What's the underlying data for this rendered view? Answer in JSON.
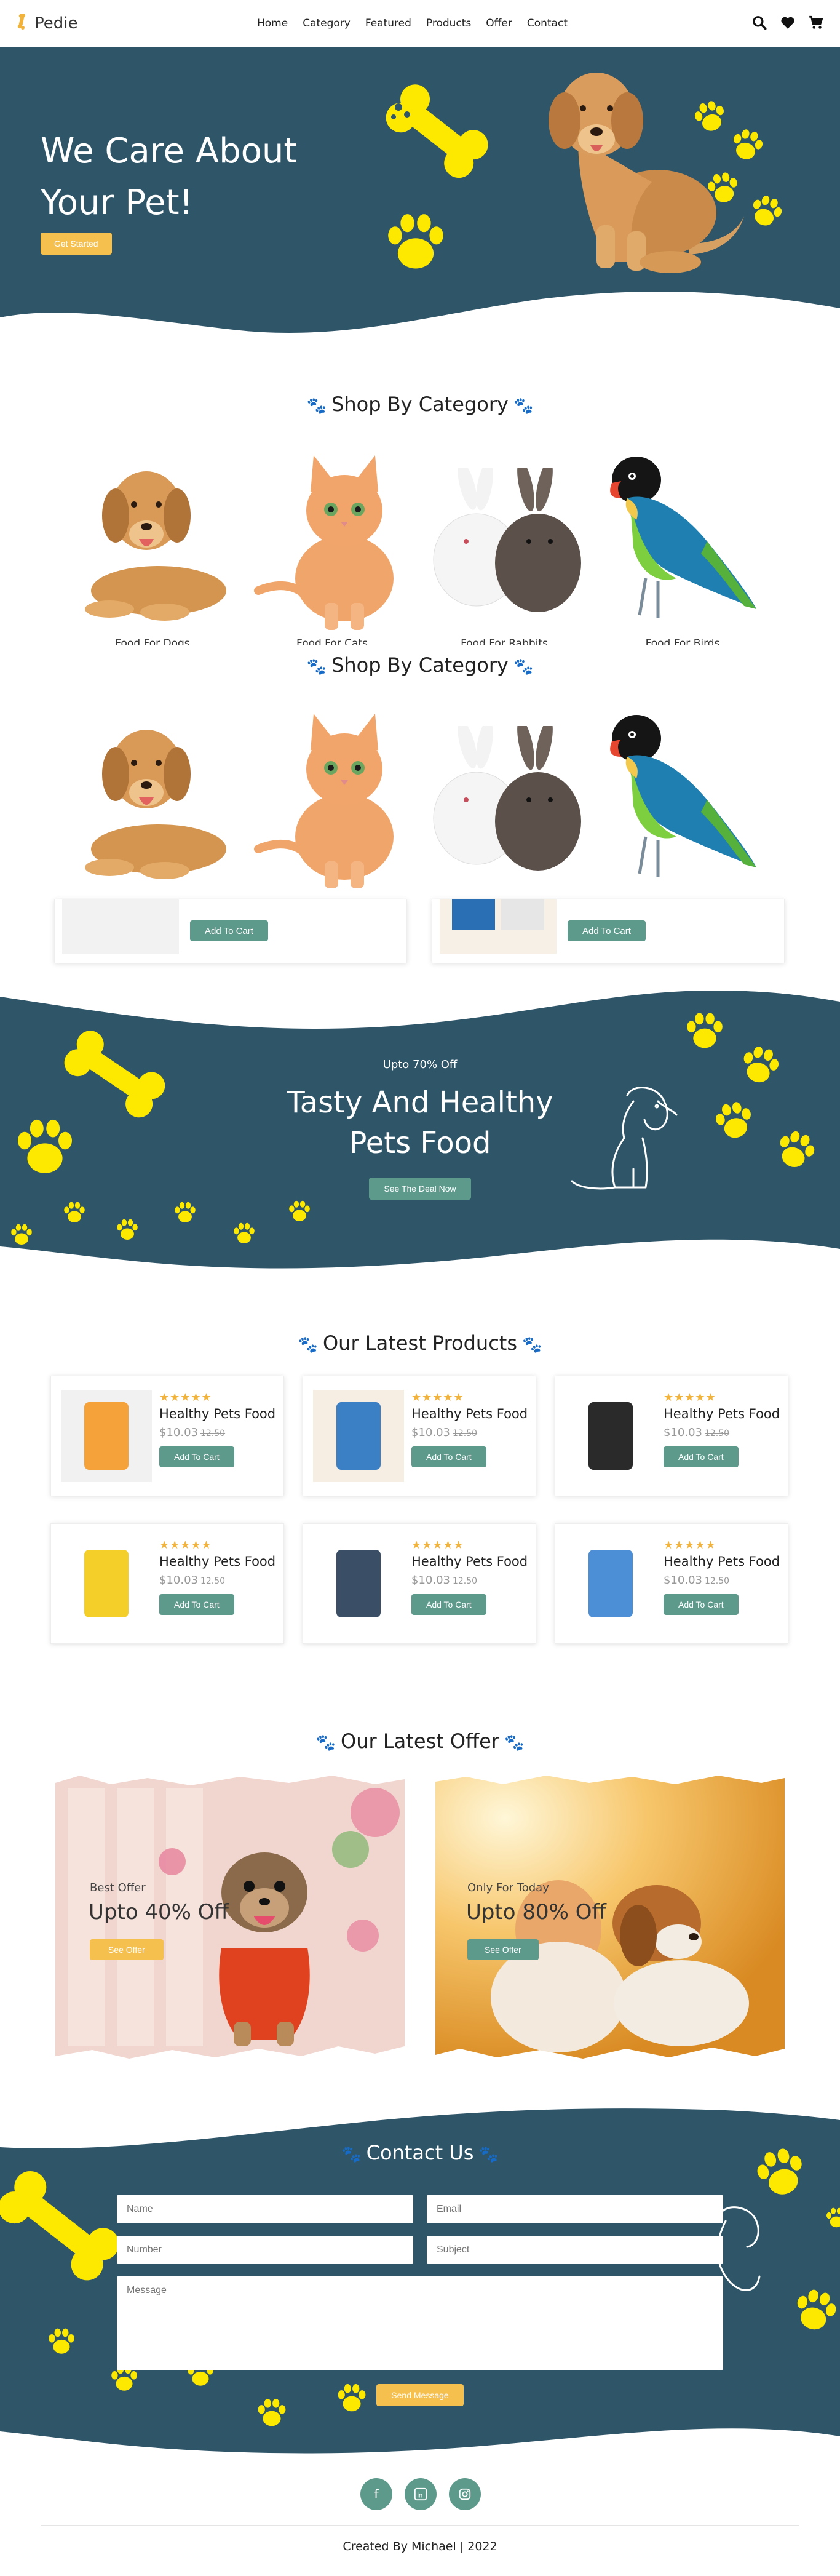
{
  "header": {
    "brand": "Pedie",
    "nav": [
      "Home",
      "Category",
      "Featured",
      "Products",
      "Offer",
      "Contact"
    ],
    "icons": [
      "search-icon",
      "heart-icon",
      "cart-icon"
    ]
  },
  "hero": {
    "title": "We Care About Your Pet!",
    "button": "Get Started"
  },
  "category": {
    "title": "Shop By Category",
    "items": [
      {
        "label": "Food For Dogs",
        "animal": "dog"
      },
      {
        "label": "Food For Cats",
        "animal": "cat"
      },
      {
        "label": "Food For Rabbits",
        "animal": "rabbit"
      },
      {
        "label": "Food For Birds",
        "animal": "bird"
      }
    ]
  },
  "category2": {
    "title": "Shop By Category"
  },
  "cart_strip": {
    "button": "Add To Cart"
  },
  "banner": {
    "kicker": "Upto 70% Off",
    "title_line1": "Tasty And Healthy",
    "title_line2": "Pets Food",
    "button": "See The Deal Now"
  },
  "products": {
    "title": "Our Latest Products",
    "items": [
      {
        "name": "Healthy Pets Food",
        "price": "$10.03",
        "old": "12.50",
        "stars": "★★★★★",
        "button": "Add To Cart"
      },
      {
        "name": "Healthy Pets Food",
        "price": "$10.03",
        "old": "12.50",
        "stars": "★★★★★",
        "button": "Add To Cart"
      },
      {
        "name": "Healthy Pets Food",
        "price": "$10.03",
        "old": "12.50",
        "stars": "★★★★★",
        "button": "Add To Cart"
      },
      {
        "name": "Healthy Pets Food",
        "price": "$10.03",
        "old": "12.50",
        "stars": "★★★★★",
        "button": "Add To Cart"
      },
      {
        "name": "Healthy Pets Food",
        "price": "$10.03",
        "old": "12.50",
        "stars": "★★★★★",
        "button": "Add To Cart"
      },
      {
        "name": "Healthy Pets Food",
        "price": "$10.03",
        "old": "12.50",
        "stars": "★★★★★",
        "button": "Add To Cart"
      }
    ]
  },
  "offers": {
    "title": "Our Latest Offer",
    "items": [
      {
        "sub": "Best Offer",
        "title": "Upto 40% Off",
        "button": "See Offer"
      },
      {
        "sub": "Only For Today",
        "title": "Upto 80% Off",
        "button": "See Offer"
      }
    ]
  },
  "contact": {
    "title": "Contact Us",
    "name_placeholder": "Name",
    "email_placeholder": "Email",
    "number_placeholder": "Number",
    "subject_placeholder": "Subject",
    "message_placeholder": "Message",
    "button": "Send Message"
  },
  "footer": {
    "credit": "Created By Michael | 2022",
    "socials": [
      "facebook-icon",
      "linkedin-icon",
      "instagram-icon"
    ]
  },
  "colors": {
    "navy": "#2f5568",
    "yellow": "#f6c04f",
    "green": "#5d9a8b",
    "paw_yellow": "#fde800"
  }
}
